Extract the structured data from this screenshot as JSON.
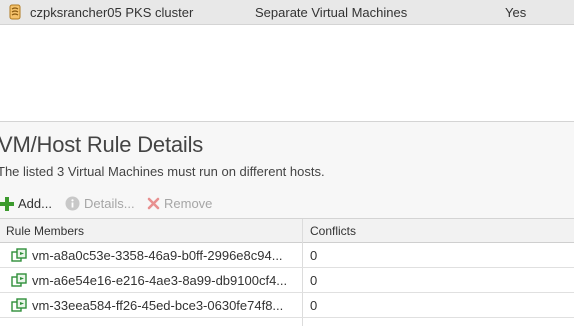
{
  "rule": {
    "name": "czpksrancher05 PKS cluster",
    "type": "Separate Virtual Machines",
    "enabled": "Yes"
  },
  "details": {
    "title": "VM/Host Rule Details",
    "description": "The listed 3 Virtual Machines must run on different hosts."
  },
  "toolbar": {
    "add_label": "Add...",
    "details_label": "Details...",
    "remove_label": "Remove"
  },
  "grid": {
    "columns": [
      "Rule Members",
      "Conflicts"
    ],
    "rows": [
      {
        "member": "vm-a8a0c53e-3358-46a9-b0ff-2996e8c94...",
        "conflicts": "0"
      },
      {
        "member": "vm-a6e54e16-e216-4ae3-8a99-db9100cf4...",
        "conflicts": "0"
      },
      {
        "member": "vm-33eea584-ff26-45ed-bce3-0630fe74f8...",
        "conflicts": "0"
      }
    ]
  },
  "icons": {
    "rule": "rule-scroll-icon",
    "add": "green-plus-icon",
    "details": "info-icon",
    "remove": "red-x-icon",
    "vm": "virtual-machine-icon"
  },
  "colors": {
    "add": "#3c9a2e",
    "disabled": "#a6a6a6",
    "remove": "#e05a5a",
    "vm_icon": "#2f8f3a"
  }
}
